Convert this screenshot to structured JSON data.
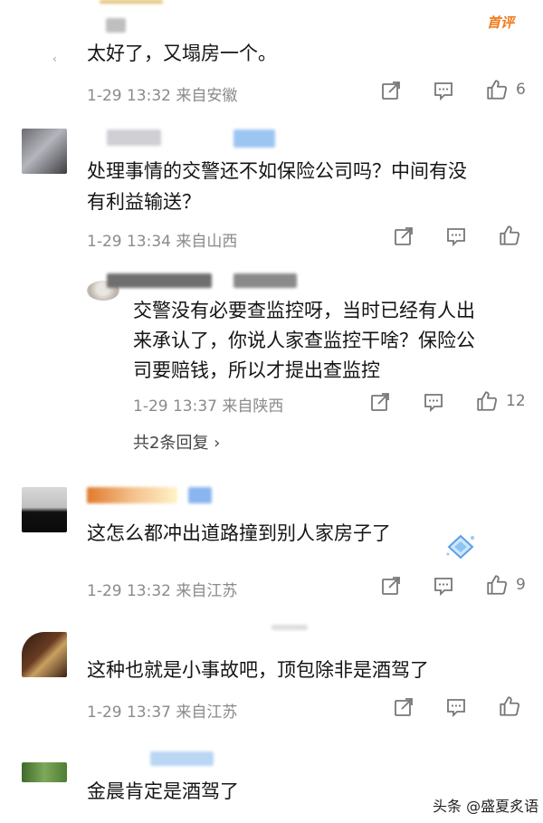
{
  "comments": [
    {
      "text": "太好了，又塌房一个。",
      "time": "1-29 13:32",
      "location": "来自安徽",
      "likes": "6"
    },
    {
      "text_line1": "处理事情的交警还不如保险公司吗？中间有没",
      "text_line2": "有利益输送？",
      "time": "1-29 13:34",
      "location": "来自山西",
      "likes": ""
    },
    {
      "text": "这怎么都冲出道路撞到别人家房子了",
      "time": "1-29 13:32",
      "location": "来自江苏",
      "likes": "9"
    },
    {
      "text": "这种也就是小事故吧，顶包除非是酒驾了",
      "time": "1-29 13:37",
      "location": "来自江苏",
      "likes": ""
    },
    {
      "text": "金晨肯定是酒驾了"
    }
  ],
  "reply": {
    "text_line1": "交警没有必要查监控呀，当时已经有人出",
    "text_line2": "来承认了，你说人家查监控干啥？保险公",
    "text_line3": "司要赔钱，所以才提出查监控",
    "time": "1-29 13:37",
    "location": "来自陕西",
    "likes": "12"
  },
  "more_replies": "共2条回复 ›",
  "first_badge": "首评",
  "watermark": "头条 @盛夏炙语",
  "icons": {
    "share": "share-icon",
    "comment": "comment-icon",
    "like": "thumbs-up-icon"
  },
  "colors": {
    "badge": "#f07a1a",
    "meta": "#8a8a8a",
    "icon": "#777777"
  }
}
